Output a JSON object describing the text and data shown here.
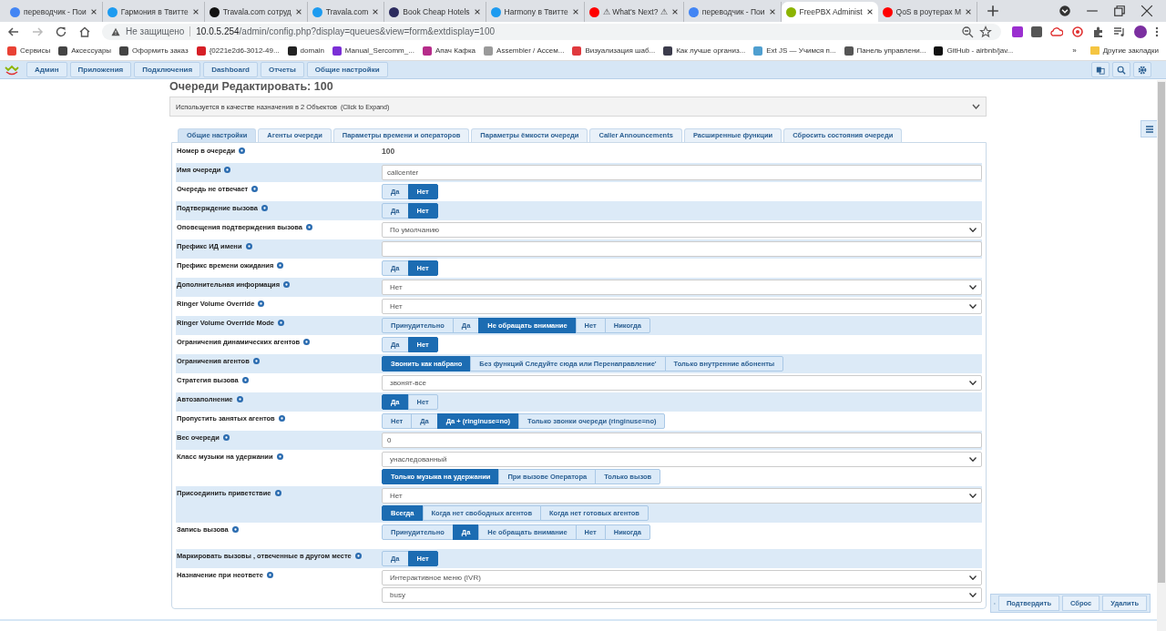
{
  "browser": {
    "tabs": [
      {
        "title": "переводчик - Пои",
        "selected": false,
        "color": "#4285f4"
      },
      {
        "title": "Гармония в Твитте",
        "selected": false,
        "color": "#1d9bf0"
      },
      {
        "title": "Travala.com сотруд",
        "selected": false,
        "color": "#111111"
      },
      {
        "title": "Travala.com",
        "selected": false,
        "color": "#1d9bf0"
      },
      {
        "title": "Book Cheap Hotels",
        "selected": false,
        "color": "#2b2b5e"
      },
      {
        "title": "Harmony в Твитте",
        "selected": false,
        "color": "#1d9bf0"
      },
      {
        "title": "⚠ What's Next? ⚠",
        "selected": false,
        "color": "#ff0000"
      },
      {
        "title": "переводчик - Пои",
        "selected": false,
        "color": "#4285f4"
      },
      {
        "title": "FreePBX Administ",
        "selected": true,
        "color": "#8cb400"
      },
      {
        "title": "QoS в роутерах M",
        "selected": false,
        "color": "#ff0000"
      }
    ],
    "security": "Не защищено",
    "url_host": "10.0.5.254",
    "url_path": "/admin/config.php?display=queues&view=form&extdisplay=100",
    "bookmarks": [
      {
        "title": "Сервисы",
        "color": "#e94235"
      },
      {
        "title": "Аксессуары",
        "color": "#444444"
      },
      {
        "title": "Оформить заказ",
        "color": "#444444"
      },
      {
        "title": "{0221e2d6-3012-49...",
        "color": "#d61f26"
      },
      {
        "title": "domain",
        "color": "#222222"
      },
      {
        "title": "Manual_Sercomm_...",
        "color": "#7b2fd6"
      },
      {
        "title": "Апач Кафка",
        "color": "#b62c8a"
      },
      {
        "title": "Assembler / Ассем...",
        "color": "#9a9a9a"
      },
      {
        "title": "Визуализация шаб...",
        "color": "#e0393e"
      },
      {
        "title": "Как лучше организ...",
        "color": "#3c3c4c"
      },
      {
        "title": "Ext JS — Учимся п...",
        "color": "#4f9fd0"
      },
      {
        "title": "Панель управлени...",
        "color": "#555555"
      },
      {
        "title": "GitHub - airbnb/jav...",
        "color": "#111111"
      }
    ],
    "more_bookmarks": "»",
    "other_bookmarks": "Другие закладки"
  },
  "nav": [
    "Админ",
    "Приложения",
    "Подключения",
    "Dashboard",
    "Отчеты",
    "Общие настройки"
  ],
  "title": "Очереди Редактировать: 100",
  "notice": {
    "text": "Используется в качестве назначения в 2 Объектов",
    "hint": "(Click to Expand)"
  },
  "tabs": [
    {
      "label": "Общие настройки",
      "selected": true
    },
    {
      "label": "Агенты очереди",
      "selected": false
    },
    {
      "label": "Параметры времени и операторов",
      "selected": false
    },
    {
      "label": "Параметры ёмкости очереди",
      "selected": false
    },
    {
      "label": "Caller Announcements",
      "selected": false
    },
    {
      "label": "Расширенные функции",
      "selected": false
    },
    {
      "label": "Сбросить состояния очереди",
      "selected": false
    }
  ],
  "rows": [
    {
      "label": "Номер в очереди",
      "controls": [
        {
          "kind": "static",
          "value": "100"
        }
      ]
    },
    {
      "label": "Имя очереди",
      "controls": [
        {
          "kind": "text",
          "value": "callcenter"
        }
      ]
    },
    {
      "label": "Очередь не отвечает",
      "controls": [
        {
          "kind": "toggle",
          "options": [
            {
              "label": "Да",
              "selected": false
            },
            {
              "label": "Нет",
              "selected": true
            }
          ]
        }
      ]
    },
    {
      "label": "Подтверждение вызова",
      "controls": [
        {
          "kind": "toggle",
          "options": [
            {
              "label": "Да",
              "selected": false
            },
            {
              "label": "Нет",
              "selected": true
            }
          ]
        }
      ]
    },
    {
      "label": "Оповещения подтверждения вызова",
      "controls": [
        {
          "kind": "select",
          "value": "По умолчанию"
        }
      ]
    },
    {
      "label": "Префикс ИД имени",
      "controls": [
        {
          "kind": "text"
        }
      ]
    },
    {
      "label": "Префикс времени ожидания",
      "controls": [
        {
          "kind": "toggle",
          "options": [
            {
              "label": "Да",
              "selected": false
            },
            {
              "label": "Нет",
              "selected": true
            }
          ]
        }
      ]
    },
    {
      "label": "Дополнительная информация",
      "controls": [
        {
          "kind": "select",
          "value": "Нет"
        }
      ]
    },
    {
      "label": "Ringer Volume Override",
      "controls": [
        {
          "kind": "select",
          "value": "Нет"
        }
      ]
    },
    {
      "label": "Ringer Volume Override Mode",
      "controls": [
        {
          "kind": "toggle",
          "options": [
            {
              "label": "Принудительно",
              "selected": false
            },
            {
              "label": "Да",
              "selected": false
            },
            {
              "label": "Не обращать внимание",
              "selected": true
            },
            {
              "label": "Нет",
              "selected": false
            },
            {
              "label": "Никогда",
              "selected": false
            }
          ]
        }
      ]
    },
    {
      "label": "Ограничения динамических агентов",
      "controls": [
        {
          "kind": "toggle",
          "options": [
            {
              "label": "Да",
              "selected": false
            },
            {
              "label": "Нет",
              "selected": true
            }
          ]
        }
      ]
    },
    {
      "label": "Ограничения агентов",
      "controls": [
        {
          "kind": "toggle",
          "options": [
            {
              "label": "Звонить как набрано",
              "selected": true
            },
            {
              "label": "Без функций Следуйте сюда или Перенаправление'",
              "selected": false
            },
            {
              "label": "Только внутренние абоненты",
              "selected": false
            }
          ]
        }
      ]
    },
    {
      "label": "Стратегия вызова",
      "controls": [
        {
          "kind": "select",
          "value": "звонят-все"
        }
      ]
    },
    {
      "label": "Автозаполнение",
      "controls": [
        {
          "kind": "toggle",
          "options": [
            {
              "label": "Да",
              "selected": true
            },
            {
              "label": "Нет",
              "selected": false
            }
          ]
        }
      ]
    },
    {
      "label": "Пропустить занятых агентов",
      "controls": [
        {
          "kind": "toggle",
          "options": [
            {
              "label": "Нет",
              "selected": false
            },
            {
              "label": "Да",
              "selected": false
            },
            {
              "label": "Да + (ringinuse=no)",
              "selected": true
            },
            {
              "label": "Только звонки очереди (ringinuse=no)",
              "selected": false
            }
          ]
        }
      ]
    },
    {
      "label": "Вес очереди",
      "controls": [
        {
          "kind": "text",
          "value": "0"
        }
      ]
    },
    {
      "label": "Класс музыки на удержании",
      "controls": [
        {
          "kind": "select",
          "value": "унаследованный"
        },
        {
          "kind": "toggle",
          "options": [
            {
              "label": "Только музыка на удержании",
              "selected": true
            },
            {
              "label": "При вызове Оператора",
              "selected": false
            },
            {
              "label": "Только вызов",
              "selected": false
            }
          ]
        }
      ]
    },
    {
      "label": "Присоединить приветствие",
      "controls": [
        {
          "kind": "select",
          "value": "Нет"
        },
        {
          "kind": "toggle",
          "options": [
            {
              "label": "Всегда",
              "selected": true
            },
            {
              "label": "Когда нет свободных агентов",
              "selected": false
            },
            {
              "label": "Когда нет готовых агентов",
              "selected": false
            }
          ]
        }
      ]
    },
    {
      "label": "Запись вызова",
      "controls": [
        {
          "kind": "toggle",
          "options": [
            {
              "label": "Принудительно",
              "selected": false
            },
            {
              "label": "Да",
              "selected": true
            },
            {
              "label": "Не обращать внимание",
              "selected": false
            },
            {
              "label": "Нет",
              "selected": false
            },
            {
              "label": "Никогда",
              "selected": false
            }
          ]
        }
      ]
    },
    {
      "label": "Маркировать вызовы , отвеченные в другом месте",
      "controls": [
        {
          "kind": "toggle",
          "options": [
            {
              "label": "Да",
              "selected": false
            },
            {
              "label": "Нет",
              "selected": true
            }
          ]
        }
      ]
    },
    {
      "label": "Назначение при неответе",
      "controls": [
        {
          "kind": "select",
          "value": "Интерактивное меню (IVR)"
        },
        {
          "kind": "select",
          "value": "busy"
        }
      ]
    }
  ],
  "actions": [
    "Подтвердить",
    "Сброс",
    "Удалить"
  ]
}
